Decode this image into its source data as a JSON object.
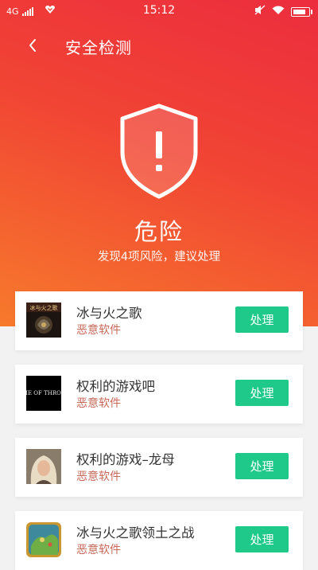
{
  "status_bar": {
    "network": "4G",
    "time": "15:12",
    "battery_level": 1.0
  },
  "header": {
    "title": "安全检测",
    "back_icon": "chevron-left-icon"
  },
  "summary": {
    "shield_icon": "shield-alert-icon",
    "status": "危险",
    "subtitle": "发现4项风险，建议处理"
  },
  "apps": [
    {
      "name": "冰与火之歌",
      "tag": "恶意软件",
      "action": "处理",
      "icon_text": "冰与火之歌"
    },
    {
      "name": "权利的游戏吧",
      "tag": "恶意软件",
      "action": "处理",
      "icon_text": "GAME OF THRONES"
    },
    {
      "name": "权利的游戏–龙母",
      "tag": "恶意软件",
      "action": "处理"
    },
    {
      "name": "冰与火之歌领土之战",
      "tag": "恶意软件",
      "action": "处理"
    }
  ],
  "colors": {
    "gradient_top": "#ec2d3e",
    "gradient_bottom": "#f77a2c",
    "action_green": "#1ec98a",
    "tag_red": "#c8695a"
  }
}
